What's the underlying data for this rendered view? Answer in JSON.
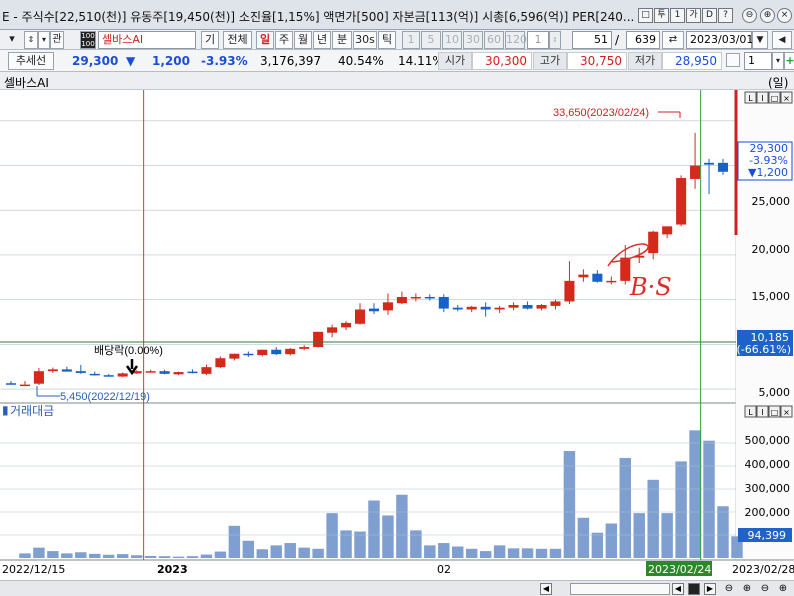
{
  "info_bar": {
    "text": "E - 주식수[22,510(천)] 유동주[19,450(천)] 소진율[1,15%] 액면가[500] 자본금[113(억)] 시총[6,596(억)] PER[240...",
    "buttons": [
      "□",
      "투",
      "1",
      "가",
      "D",
      "?",
      "⊖",
      "⊕",
      "×"
    ]
  },
  "toolbar": {
    "search_label": "관",
    "stock_name": "셀바스AI",
    "buttons": [
      "기",
      "전체",
      "일",
      "주",
      "월",
      "년",
      "분",
      "30s",
      "틱"
    ],
    "period_buttons": [
      "1",
      "5",
      "10",
      "30",
      "60",
      "120"
    ],
    "period_value": "1",
    "view_count": "51",
    "total_count": "639",
    "date": "2023/03/01"
  },
  "quote": {
    "trend_button": "추세선",
    "price": "29,300",
    "change_arrow": "▼",
    "change": "1,200",
    "change_pct": "-3.93%",
    "volume": "3,176,397",
    "pct_a": "40.54%",
    "pct_b": "14.11%",
    "open_label": "시가",
    "open": "30,300",
    "high_label": "고가",
    "high": "30,750",
    "low_label": "저가",
    "low": "28,950",
    "right_value": "1"
  },
  "chart_header": {
    "title": "셀바스AI",
    "unit": "(일)",
    "volume_title": "거래대금",
    "panel_buttons": [
      "L",
      "I",
      "□",
      "×"
    ]
  },
  "annotations": {
    "high_label": "33,650(2023/02/24)",
    "low_label": "5,450(2022/12/19)",
    "dividend_label": "배당락(0.00%)",
    "handwriting": "B·S"
  },
  "price_axis": {
    "ticks": [
      "5,000",
      "15,000",
      "20,000",
      "25,000"
    ],
    "current": "29,300",
    "current_pct": "-3.93%",
    "current_change": "▼1,200",
    "ref_value": "10,185",
    "ref_pct": "(-66.61%)"
  },
  "volume_axis": {
    "ticks": [
      "200,000",
      "300,000",
      "400,000",
      "500,000"
    ],
    "current": "94,399"
  },
  "date_axis": [
    "2022/12/15",
    "2023",
    "02",
    "2023/02/24",
    "2023/02/28"
  ],
  "colors": {
    "up": "#d42a1c",
    "down": "#1861c9",
    "volume": "#7f9fd0",
    "grid": "#b8c2cc",
    "cursor": "#2f9a3a",
    "divider": "#d23a3a"
  },
  "chart_data": {
    "type": "candlestick",
    "title": "셀바스AI",
    "price_ylim": [
      4000,
      38000
    ],
    "volume_ylim": [
      0,
      600000
    ],
    "candles": [
      {
        "o": 5650,
        "h": 5900,
        "l": 5550,
        "c": 5550
      },
      {
        "o": 5450,
        "h": 5900,
        "l": 5450,
        "c": 5500
      },
      {
        "o": 5600,
        "h": 7350,
        "l": 5450,
        "c": 7000
      },
      {
        "o": 7000,
        "h": 7400,
        "l": 6800,
        "c": 7200
      },
      {
        "o": 7200,
        "h": 7500,
        "l": 6950,
        "c": 6950
      },
      {
        "o": 7000,
        "h": 7700,
        "l": 6700,
        "c": 6800
      },
      {
        "o": 6700,
        "h": 6950,
        "l": 6500,
        "c": 6550
      },
      {
        "o": 6550,
        "h": 6700,
        "l": 6400,
        "c": 6450
      },
      {
        "o": 6400,
        "h": 6850,
        "l": 6350,
        "c": 6750
      },
      {
        "o": 6750,
        "h": 7100,
        "l": 6700,
        "c": 7000
      },
      {
        "o": 7000,
        "h": 7150,
        "l": 6900,
        "c": 7000
      },
      {
        "o": 7000,
        "h": 7150,
        "l": 6650,
        "c": 6700
      },
      {
        "o": 6650,
        "h": 6950,
        "l": 6550,
        "c": 6900
      },
      {
        "o": 6950,
        "h": 7200,
        "l": 6750,
        "c": 6800
      },
      {
        "o": 6700,
        "h": 7750,
        "l": 6550,
        "c": 7450
      },
      {
        "o": 7450,
        "h": 8650,
        "l": 7350,
        "c": 8450
      },
      {
        "o": 8400,
        "h": 8950,
        "l": 8200,
        "c": 8950
      },
      {
        "o": 8950,
        "h": 9200,
        "l": 8600,
        "c": 8800
      },
      {
        "o": 8800,
        "h": 9400,
        "l": 8650,
        "c": 9400
      },
      {
        "o": 9400,
        "h": 9700,
        "l": 8800,
        "c": 8900
      },
      {
        "o": 8900,
        "h": 9600,
        "l": 8750,
        "c": 9500
      },
      {
        "o": 9500,
        "h": 9900,
        "l": 9350,
        "c": 9700
      },
      {
        "o": 9700,
        "h": 11400,
        "l": 9650,
        "c": 11400
      },
      {
        "o": 11300,
        "h": 12200,
        "l": 10800,
        "c": 11900
      },
      {
        "o": 11900,
        "h": 12600,
        "l": 11600,
        "c": 12400
      },
      {
        "o": 12300,
        "h": 14600,
        "l": 12200,
        "c": 13900
      },
      {
        "o": 14000,
        "h": 14600,
        "l": 13400,
        "c": 13700
      },
      {
        "o": 13800,
        "h": 15700,
        "l": 13300,
        "c": 14700
      },
      {
        "o": 14600,
        "h": 15900,
        "l": 14500,
        "c": 15300
      },
      {
        "o": 15300,
        "h": 15700,
        "l": 14800,
        "c": 15300
      },
      {
        "o": 15300,
        "h": 15600,
        "l": 14900,
        "c": 15200
      },
      {
        "o": 15300,
        "h": 15600,
        "l": 13600,
        "c": 14000
      },
      {
        "o": 14100,
        "h": 14400,
        "l": 13700,
        "c": 13900
      },
      {
        "o": 13900,
        "h": 14300,
        "l": 13600,
        "c": 14200
      },
      {
        "o": 14200,
        "h": 14700,
        "l": 13100,
        "c": 13900
      },
      {
        "o": 13900,
        "h": 14300,
        "l": 13500,
        "c": 14100
      },
      {
        "o": 14100,
        "h": 14700,
        "l": 13800,
        "c": 14400
      },
      {
        "o": 14400,
        "h": 14800,
        "l": 13900,
        "c": 14000
      },
      {
        "o": 14000,
        "h": 14500,
        "l": 13800,
        "c": 14400
      },
      {
        "o": 14300,
        "h": 15000,
        "l": 13900,
        "c": 14800
      },
      {
        "o": 14800,
        "h": 19300,
        "l": 14500,
        "c": 17100
      },
      {
        "o": 17500,
        "h": 18400,
        "l": 17000,
        "c": 17800
      },
      {
        "o": 17900,
        "h": 18300,
        "l": 16900,
        "c": 17000
      },
      {
        "o": 17000,
        "h": 17600,
        "l": 16700,
        "c": 17100
      },
      {
        "o": 17100,
        "h": 21100,
        "l": 16700,
        "c": 19700
      },
      {
        "o": 19700,
        "h": 20800,
        "l": 19100,
        "c": 19900
      },
      {
        "o": 20200,
        "h": 22700,
        "l": 19500,
        "c": 22600
      },
      {
        "o": 22300,
        "h": 23100,
        "l": 21900,
        "c": 23200
      },
      {
        "o": 23400,
        "h": 28900,
        "l": 23200,
        "c": 28600
      },
      {
        "o": 28500,
        "h": 33650,
        "l": 27400,
        "c": 30000
      },
      {
        "o": 30300,
        "h": 30750,
        "l": 26800,
        "c": 30100
      },
      {
        "o": 30300,
        "h": 30750,
        "l": 28950,
        "c": 29300
      }
    ],
    "volumes": [
      0,
      20000,
      45000,
      30000,
      20000,
      25000,
      18000,
      14000,
      17000,
      12000,
      9000,
      8000,
      6000,
      8000,
      15000,
      28000,
      140000,
      75000,
      38000,
      55000,
      65000,
      45000,
      40000,
      195000,
      120000,
      115000,
      250000,
      185000,
      275000,
      120000,
      55000,
      65000,
      50000,
      40000,
      30000,
      55000,
      42000,
      42000,
      40000,
      40000,
      465000,
      175000,
      110000,
      150000,
      435000,
      195000,
      340000,
      195000,
      420000,
      555000,
      510000,
      225000,
      94399
    ]
  }
}
